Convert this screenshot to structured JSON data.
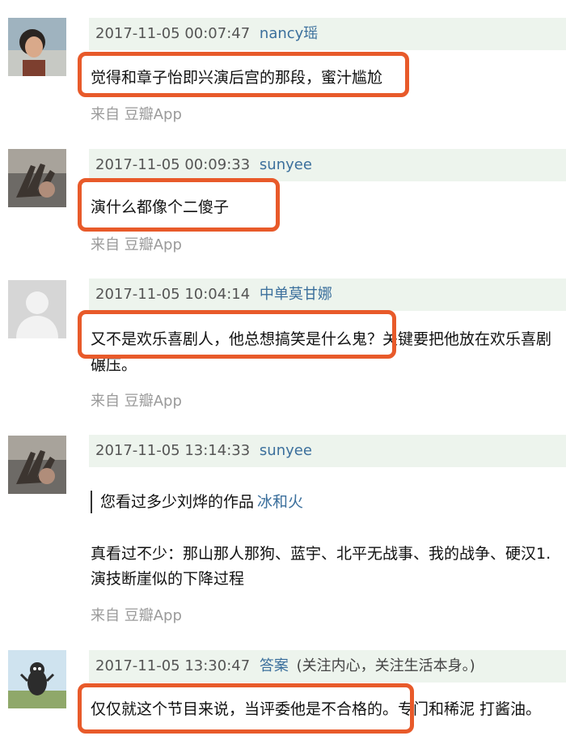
{
  "comments": [
    {
      "time": "2017-11-05 00:07:47",
      "user": "nancy瑶",
      "text": "觉得和章子怡即兴演后宫的那段，蜜汁尴尬",
      "source": "来自 豆瓣App",
      "avatar": "avatar-photo-woman"
    },
    {
      "time": "2017-11-05 00:09:33",
      "user": "sunyee",
      "text": "演什么都像个二傻子",
      "source": "来自 豆瓣App",
      "avatar": "avatar-photo-hand"
    },
    {
      "time": "2017-11-05 10:04:14",
      "user": "中单莫甘娜",
      "text": "又不是欢乐喜剧人，他总想搞笑是什么鬼？关键要把他放在欢乐喜剧",
      "text2": "碾压。",
      "source": "来自 豆瓣App",
      "avatar": "avatar-default-gray"
    },
    {
      "time": "2017-11-05 13:14:33",
      "user": "sunyee",
      "quote": "您看过多少刘烨的作品",
      "quote_user": "冰和火",
      "text": "真看过不少：那山那人那狗、蓝宇、北平无战事、我的战争、硬汉1.",
      "text2": "演技断崖似的下降过程",
      "source": "来自 豆瓣App",
      "avatar": "avatar-photo-hand"
    },
    {
      "time": "2017-11-05 13:30:47",
      "user": "答案",
      "signature": "(关注内心，关注生活本身。)",
      "text": "仅仅就这个节目来说，当评委他是不合格的。专门和稀泥 打酱油。",
      "avatar": "avatar-cartoon-cat"
    }
  ],
  "colors": {
    "highlight": "#e85a2a",
    "meta_bg": "#edf4ed",
    "link": "#3b6f9c"
  }
}
